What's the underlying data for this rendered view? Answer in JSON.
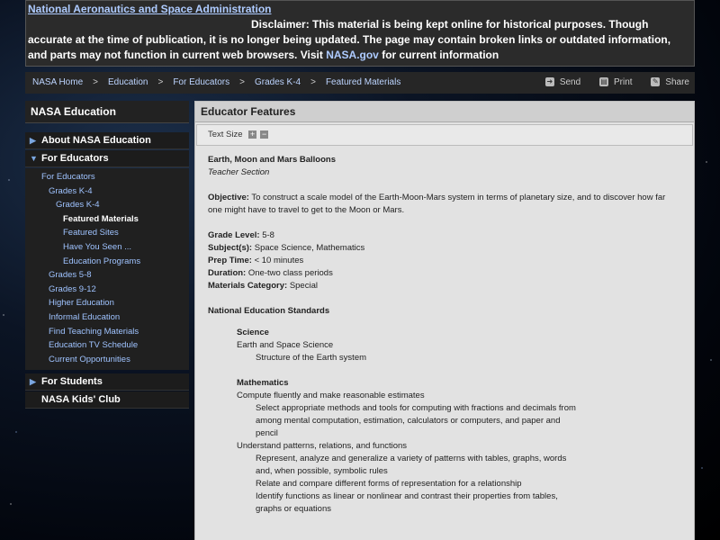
{
  "header": {
    "agency": "National Aeronautics and Space Administration",
    "disclaimer_text": "Disclaimer: This material is being kept online for historical purposes. Though accurate at the time of publication, it is no longer being updated. The page may contain broken links or outdated information, and parts may not function in current web browsers. Visit",
    "disclaimer_link": "NASA.gov",
    "disclaimer_tail": "for current information"
  },
  "breadcrumb": {
    "items": [
      "NASA Home",
      "Education",
      "For Educators",
      "Grades K-4",
      "Featured Materials"
    ],
    "separator": ">"
  },
  "tools": {
    "send": "Send",
    "print": "Print",
    "share": "Share"
  },
  "sidebar": {
    "title": "NASA Education",
    "about": "About NASA Education",
    "educators": "For Educators",
    "links": [
      "For Educators",
      "Grades K-4",
      "Grades K-4",
      "Featured Materials",
      "Featured Sites",
      "Have You Seen ...",
      "Education Programs",
      "Grades 5-8",
      "Grades 9-12",
      "Higher Education",
      "Informal Education",
      "Find Teaching Materials",
      "Education TV Schedule",
      "Current Opportunities"
    ],
    "students": "For Students",
    "kids": "NASA Kids' Club"
  },
  "main": {
    "title": "Educator Features",
    "text_size_label": "Text Size",
    "article_title": "Earth, Moon and Mars Balloons",
    "section": "Teacher Section",
    "objective_label": "Objective:",
    "objective_text": "To construct a scale model of the Earth-Moon-Mars system in terms of planetary size, and to discover how far one might have to travel to get to the Moon or Mars.",
    "grade_label": "Grade Level:",
    "grade_value": "5-8",
    "subjects_label": "Subject(s):",
    "subjects_value": "Space Science, Mathematics",
    "prep_label": "Prep Time:",
    "prep_value": "< 10 minutes",
    "duration_label": "Duration:",
    "duration_value": "One-two class periods",
    "materials_label": "Materials Category:",
    "materials_value": "Special",
    "standards_title": "National Education Standards",
    "science_title": "Science",
    "science_sub": "Earth and Space Science",
    "science_item": "Structure of the Earth system",
    "math_title": "Mathematics",
    "math_sub1": "Compute fluently and make reasonable estimates",
    "math_item1": "Select appropriate methods and tools for computing with fractions and decimals from among mental computation, estimation, calculators or computers, and paper and pencil",
    "math_sub2": "Understand patterns, relations, and functions",
    "math_item2": "Represent, analyze and generalize a variety of patterns with tables, graphs, words and, when possible, symbolic rules",
    "math_item3": "Relate and compare different forms of representation for a relationship",
    "math_item4": "Identify functions as linear or nonlinear and contrast their properties from tables, graphs or equations"
  }
}
